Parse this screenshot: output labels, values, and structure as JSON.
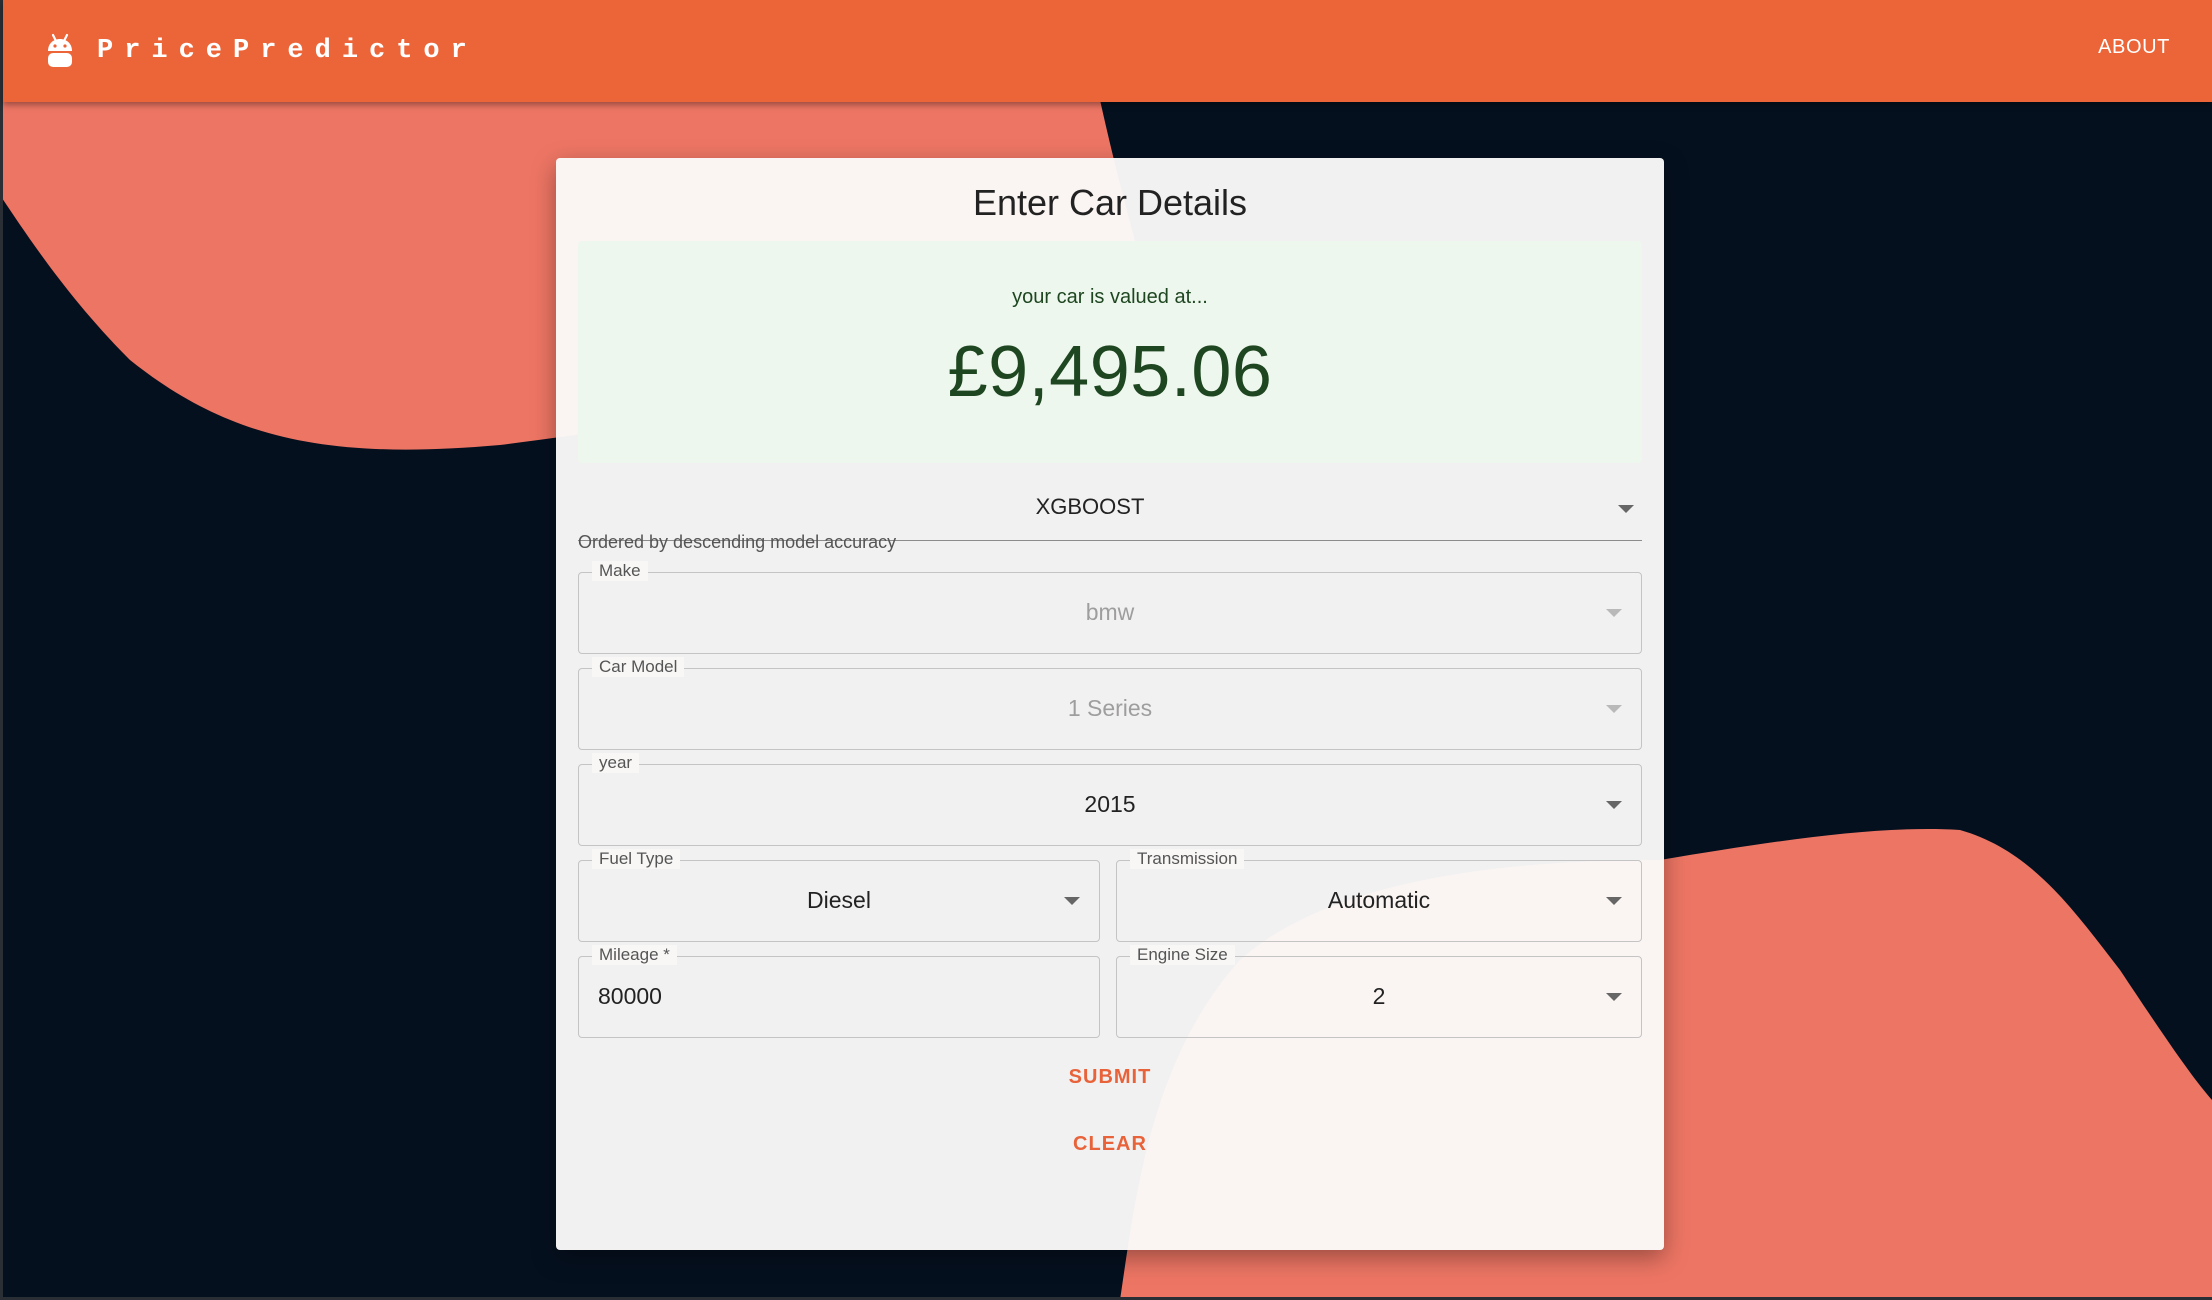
{
  "header": {
    "brand": "PricePredictor",
    "about_label": "ABOUT"
  },
  "card": {
    "title": "Enter Car Details",
    "result": {
      "label": "your car is valued at...",
      "value": "£9,495.06"
    },
    "model_select": {
      "value": "XGBOOST",
      "helper": "Ordered by descending model accuracy"
    },
    "fields": {
      "make": {
        "label": "Make",
        "value": "bmw"
      },
      "car_model": {
        "label": "Car Model",
        "value": "1 Series"
      },
      "year": {
        "label": "year",
        "value": "2015"
      },
      "fuel_type": {
        "label": "Fuel Type",
        "value": "Diesel"
      },
      "transmission": {
        "label": "Transmission",
        "value": "Automatic"
      },
      "mileage": {
        "label": "Mileage *",
        "value": "80000"
      },
      "engine_size": {
        "label": "Engine Size",
        "value": "2"
      }
    },
    "submit_label": "SUBMIT",
    "clear_label": "CLEAR"
  },
  "colors": {
    "header": "#ec6538",
    "background": "#05101f",
    "blob": "#ed7564",
    "accent": "#e8623a",
    "success_bg": "#edf7ed",
    "success_text": "#1e4620"
  },
  "icons": {
    "brand": "android-robot-icon",
    "dropdown": "caret-down-icon"
  }
}
